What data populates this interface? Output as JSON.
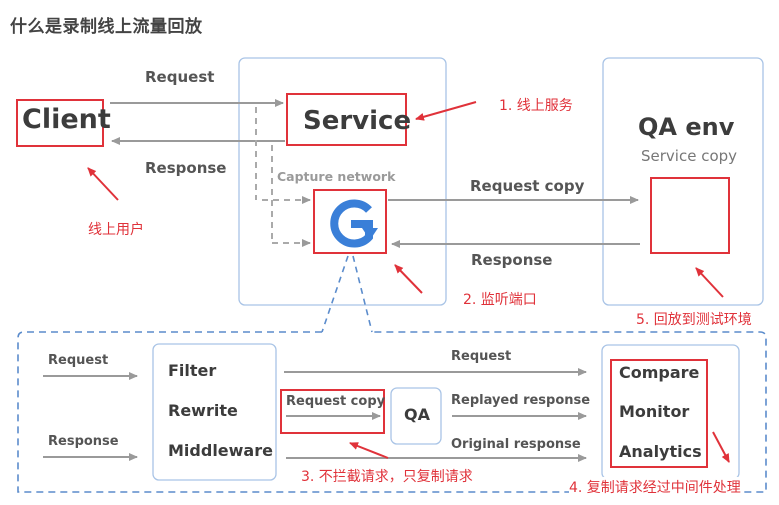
{
  "title": "什么是录制线上流量回放",
  "colors": {
    "panel_border": "#a9c4e6",
    "highlight_red": "#e0323a",
    "arrow_gray": "#9a9a9a",
    "dashed_gray": "#aaaaaa",
    "dashed_blue": "#5b8ccc",
    "logo_blue": "#3a7fd8",
    "text_dark": "#3c3c3c",
    "text_gray": "#555555",
    "text_light": "#9a9a9a"
  },
  "top": {
    "client": {
      "label": "Client",
      "annotation": "线上用户"
    },
    "links": {
      "request": "Request",
      "response": "Response",
      "request_copy": "Request copy",
      "copy_response": "Response"
    },
    "service_panel": {
      "service_label": "Service",
      "capture_label": "Capture network",
      "logo_icon": "goreplay-icon"
    },
    "qa_panel": {
      "title": "QA env",
      "subtitle": "Service copy"
    },
    "annotations": {
      "step1": "1. 线上服务",
      "step2": "2. 监听端口",
      "step5": "5. 回放到测试环境"
    }
  },
  "bottom": {
    "inputs": {
      "request": "Request",
      "response": "Response"
    },
    "middleware_box": {
      "items": [
        "Filter",
        "Rewrite",
        "Middleware"
      ]
    },
    "flows": {
      "request": "Request",
      "request_copy": "Request copy",
      "replayed_response": "Replayed response",
      "original_response": "Original response"
    },
    "qa_box": "QA",
    "analysis_box": {
      "items": [
        "Compare",
        "Monitor",
        "Analytics"
      ]
    },
    "annotations": {
      "step3": "3. 不拦截请求，只复制请求",
      "step4": "4. 复制请求经过中间件处理"
    }
  }
}
